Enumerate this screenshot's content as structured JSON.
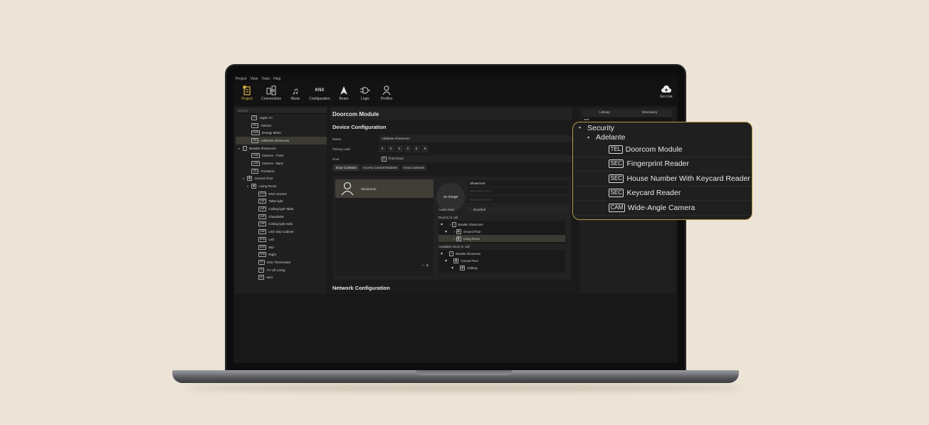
{
  "menu": [
    "Project",
    "View",
    "Tools",
    "Help"
  ],
  "toolbar": {
    "project": "Project",
    "connections": "Connections",
    "music": "Music",
    "knx_glyph": "KNX",
    "configuration": "Configuration",
    "beam": "Beam",
    "logic": "Logic",
    "profiles": "Profiles",
    "golive": "Go Live"
  },
  "left": {
    "search_placeholder": "Search",
    "items": [
      {
        "tag": "TV",
        "label": "Apple TV"
      },
      {
        "tag": "TEL",
        "label": "Telenet"
      },
      {
        "tag": "PWR",
        "label": "Energy Meter"
      },
      {
        "tag": "TEL",
        "label": "Adelante showroom"
      },
      {
        "tag": "",
        "label": "Basalte Showroom"
      },
      {
        "tag": "CAM",
        "label": "Camera - Front"
      },
      {
        "tag": "CAM",
        "label": "Camera - Back"
      },
      {
        "tag": "TEL",
        "label": "Frontdoor"
      },
      {
        "tag": "",
        "label": "Ground Floor"
      },
      {
        "tag": "",
        "label": "Living Room"
      },
      {
        "tag": "SCN",
        "label": "KNX Scenes"
      },
      {
        "tag": "LMP",
        "label": "Table light"
      },
      {
        "tag": "LMP",
        "label": "Ceiling light Table"
      },
      {
        "tag": "LMP",
        "label": "Chandelier"
      },
      {
        "tag": "LMP",
        "label": "Ceiling light Sofa"
      },
      {
        "tag": "LMP",
        "label": "LED strip Cabinet"
      },
      {
        "tag": "SHD",
        "label": "Left"
      },
      {
        "tag": "SHD",
        "label": "Mid"
      },
      {
        "tag": "SHD",
        "label": "Right"
      },
      {
        "tag": "TH",
        "label": "KNX Thermostat"
      },
      {
        "tag": "TV",
        "label": "TV Lift Living"
      },
      {
        "tag": "AV",
        "label": "asro"
      }
    ],
    "bottom": "-  +"
  },
  "middle": {
    "module_title": "Doorcom Module",
    "device_config": "Device Configuration",
    "name_label": "Name",
    "name_value": "Adelante showroom",
    "pairing_label": "Pairing code",
    "pairing_digits": [
      "3",
      "0",
      "0",
      "0",
      "0",
      "9"
    ],
    "door_label": "Door",
    "door_value": "Front Door",
    "tabs": [
      "Door Contacts",
      "Access Control Modules",
      "Extra cameras"
    ],
    "contact_name": "Showroom",
    "no_image": "no image",
    "field_name": "Showroom",
    "extra1": "Extra info line 1",
    "extra2": "Extra info line 2",
    "audio_label": "Audio Alert",
    "audio_value": "Doorbell",
    "rooms_label": "Rooms to call",
    "rooms": [
      "Basalte Showroom",
      "Ground Floor",
      "Living Room"
    ],
    "avail_label": "Available doors in call",
    "avail": [
      "Basalte Showroom",
      "Ground Floor",
      "Hallway"
    ],
    "pm": "-  +",
    "network_config": "Network Configuration"
  },
  "right": {
    "tab_library": "Library",
    "tab_discovery": "Discovery",
    "search_value": "adel"
  },
  "popup": {
    "security": "Security",
    "adelante": "Adelante",
    "items": [
      {
        "tag": "TEL",
        "label": "Doorcom Module"
      },
      {
        "tag": "SEC",
        "label": "Fingerprint Reader"
      },
      {
        "tag": "SEC",
        "label": "House Number With Keycard Reader"
      },
      {
        "tag": "SEC",
        "label": "Keycard Reader"
      },
      {
        "tag": "CAM",
        "label": "Wide-Angle Camera"
      }
    ]
  },
  "colors": {
    "accent": "#d8b84a",
    "popup_border": "#b59942",
    "background": "#ece4d7"
  }
}
